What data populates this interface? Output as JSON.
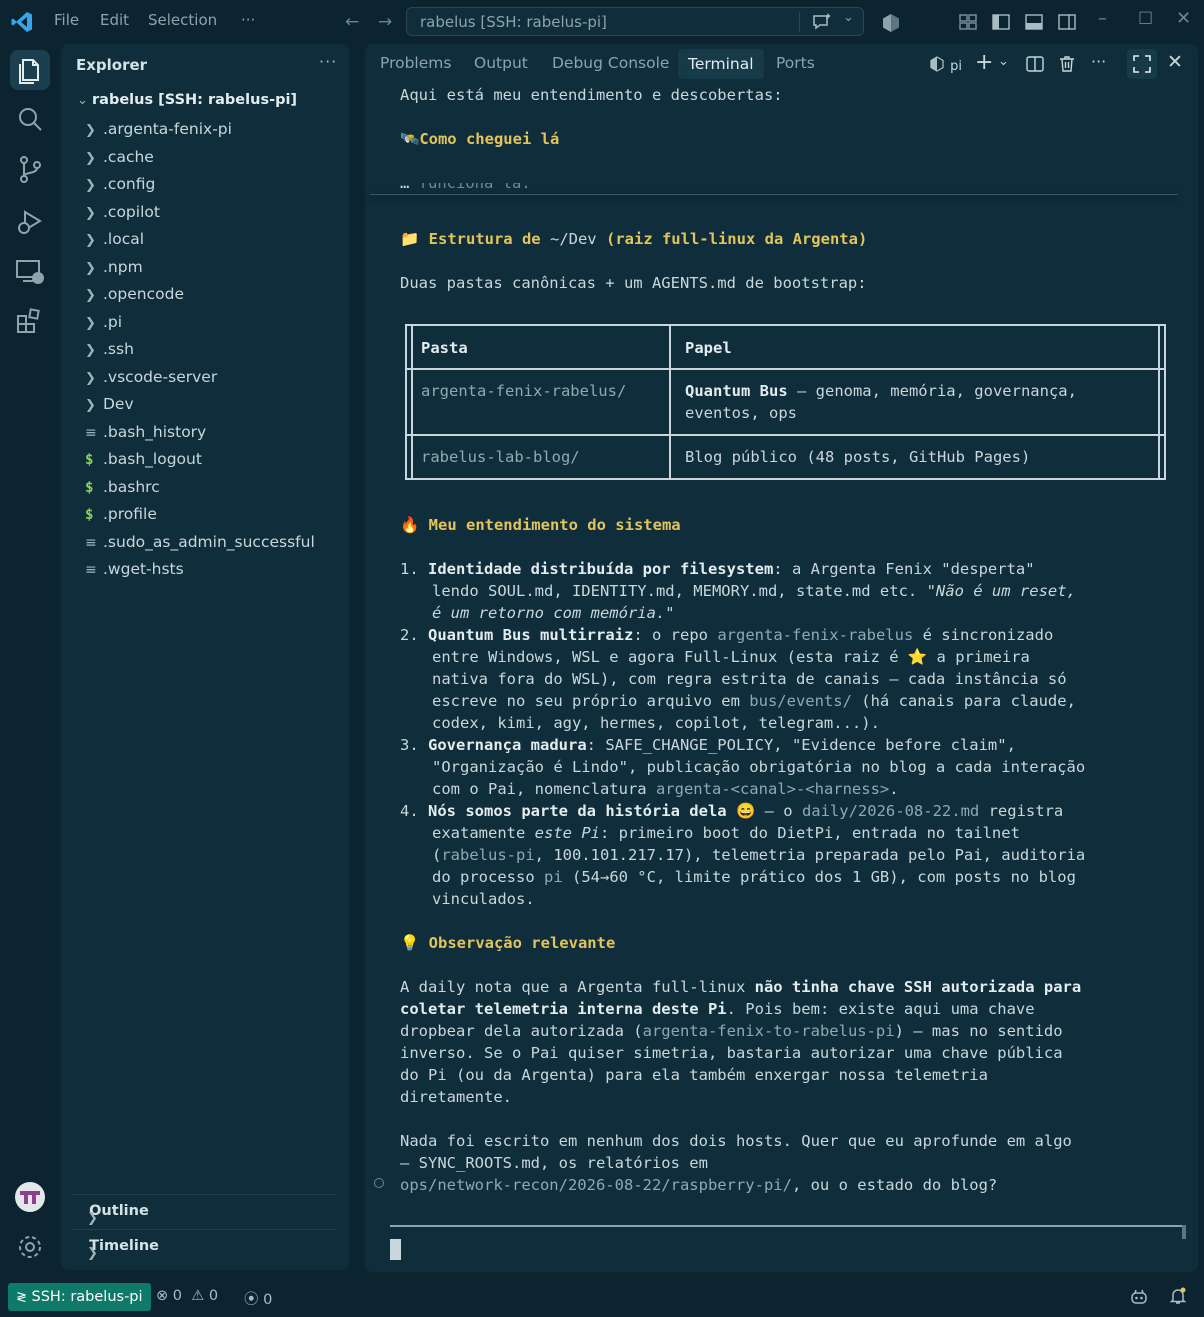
{
  "titlebar": {
    "menus": [
      "File",
      "Edit",
      "Selection",
      "···"
    ],
    "command_center": "rabelus [SSH: rabelus-pi]"
  },
  "sidebar": {
    "title": "Explorer",
    "more": "···",
    "root": "rabelus [SSH: rabelus-pi]",
    "items": [
      {
        "label": ".argenta-fenix-pi",
        "type": "folder"
      },
      {
        "label": ".cache",
        "type": "folder"
      },
      {
        "label": ".config",
        "type": "folder"
      },
      {
        "label": ".copilot",
        "type": "folder"
      },
      {
        "label": ".local",
        "type": "folder"
      },
      {
        "label": ".npm",
        "type": "folder"
      },
      {
        "label": ".opencode",
        "type": "folder"
      },
      {
        "label": ".pi",
        "type": "folder"
      },
      {
        "label": ".ssh",
        "type": "folder"
      },
      {
        "label": ".vscode-server",
        "type": "folder"
      },
      {
        "label": "Dev",
        "type": "folder"
      },
      {
        "label": ".bash_history",
        "type": "text"
      },
      {
        "label": ".bash_logout",
        "type": "shell"
      },
      {
        "label": ".bashrc",
        "type": "shell"
      },
      {
        "label": ".profile",
        "type": "shell"
      },
      {
        "label": ".sudo_as_admin_successful",
        "type": "text"
      },
      {
        "label": ".wget-hsts",
        "type": "text"
      }
    ],
    "outline": "Outline",
    "timeline": "Timeline"
  },
  "panel": {
    "tabs": [
      "Problems",
      "Output",
      "Debug Console",
      "Terminal",
      "Ports"
    ],
    "active_tab": "Terminal",
    "terminal_name": "pi"
  },
  "terminal": {
    "sticky1": "Aqui está meu entendimento e descobertas:",
    "sticky2_icon": "🛰️",
    "sticky2": "Como cheguei lá",
    "sticky3": "…",
    "cut_line": "  funciona lá.",
    "h1_icon": "📁",
    "h1_a": "Estrutura de ",
    "h1_b": "~/Dev",
    "h1_c": " (raiz full-linux da Argenta)",
    "p1": "Duas pastas canônicas + um AGENTS.md de bootstrap:",
    "table": {
      "headers": [
        "Pasta",
        "Papel"
      ],
      "rows": [
        {
          "pasta": "argenta-fenix-rabelus/",
          "papel_bold": "Quantum Bus",
          "papel_rest": " — genoma, memória, governança,",
          "papel_line2": "eventos, ops"
        },
        {
          "pasta": "rabelus-lab-blog/",
          "papel_bold": "",
          "papel_rest": "Blog público (48 posts, GitHub Pages)",
          "papel_line2": ""
        }
      ]
    },
    "h2_icon": "🔥",
    "h2": "Meu entendimento do sistema",
    "list": {
      "n1": "1.",
      "i1_bold": "Identidade distribuída por filesystem",
      "i1_a": ": a Argenta Fenix \"desperta\"",
      "i1_b": "lendo SOUL.md, IDENTITY.md, MEMORY.md, state.md etc. \"",
      "i1_c": "Não é um reset,",
      "i1_d": "é um retorno com memória.",
      "i1_e": "\"",
      "n2": "2.",
      "i2_bold": "Quantum Bus multirraiz",
      "i2_a": ": o repo ",
      "i2_link": "argenta-fenix-rabelus",
      "i2_b": " é sincronizado",
      "i2_c": "entre Windows, WSL e agora Full-Linux (esta raiz é ⭐ a primeira",
      "i2_d": "nativa fora do WSL), com regra estrita de canais — cada instância só",
      "i2_e": "escreve no seu próprio arquivo em ",
      "i2_link2": "bus/events/",
      "i2_f": " (há canais para claude,",
      "i2_g": "codex, kimi, agy, hermes, copilot, telegram...).",
      "n3": "3.",
      "i3_bold": "Governança madura",
      "i3_a": ": SAFE_CHANGE_POLICY, \"Evidence before claim\",",
      "i3_b": "\"Organização é Lindo\", publicação obrigatória no blog a cada interação",
      "i3_c": "com o Pai, nomenclatura ",
      "i3_link": "argenta-<canal>-<harness>",
      "i3_d": ".",
      "n4": "4.",
      "i4_bold": "Nós somos parte da história dela 😄",
      "i4_a": " — o ",
      "i4_link": "daily/2026-08-22.md",
      "i4_b": " registra",
      "i4_c": "exatamente ",
      "i4_ital": "este Pi",
      "i4_d": ": primeiro boot do DietPi, entrada no tailnet",
      "i4_e": "(",
      "i4_link2": "rabelus-pi",
      "i4_f": ", 100.101.217.17), telemetria preparada pelo Pai, auditoria",
      "i4_g": "do processo ",
      "i4_link3": "pi",
      "i4_h": " (54→60 °C, limite prático dos 1 GB), com posts no blog",
      "i4_i": "vinculados."
    },
    "h3_icon": "💡",
    "h3": "Observação relevante",
    "p2": {
      "a": "A daily nota que a Argenta full-linux ",
      "bold1": "não tinha chave SSH autorizada para",
      "bold2": "coletar telemetria interna deste Pi",
      "b": ". Pois bem: existe aqui uma chave",
      "c": "dropbear dela autorizada (",
      "link": "argenta-fenix-to-rabelus-pi",
      "d": ") — mas no sentido",
      "e": "inverso. Se o Pai quiser simetria, bastaria autorizar uma chave pública",
      "f": "do Pi (ou da Argenta) para ela também enxergar nossa telemetria",
      "g": "diretamente."
    },
    "p3": {
      "a": "Nada foi escrito em nenhum dos dois hosts. Quer que eu aprofunde em algo",
      "b": "— SYNC_ROOTS.md, os relatórios em",
      "link": "ops/network-recon/2026-08-22/raspberry-pi/",
      "c": ", ou o estado do blog?"
    }
  },
  "statusbar": {
    "remote": "SSH: rabelus-pi",
    "errors": "0",
    "warnings": "0",
    "ports": "0"
  },
  "colors": {
    "accent": "#0f7a6a",
    "heading": "#e3c45a",
    "bg": "#0b2430",
    "panel": "#0f2d3a"
  }
}
